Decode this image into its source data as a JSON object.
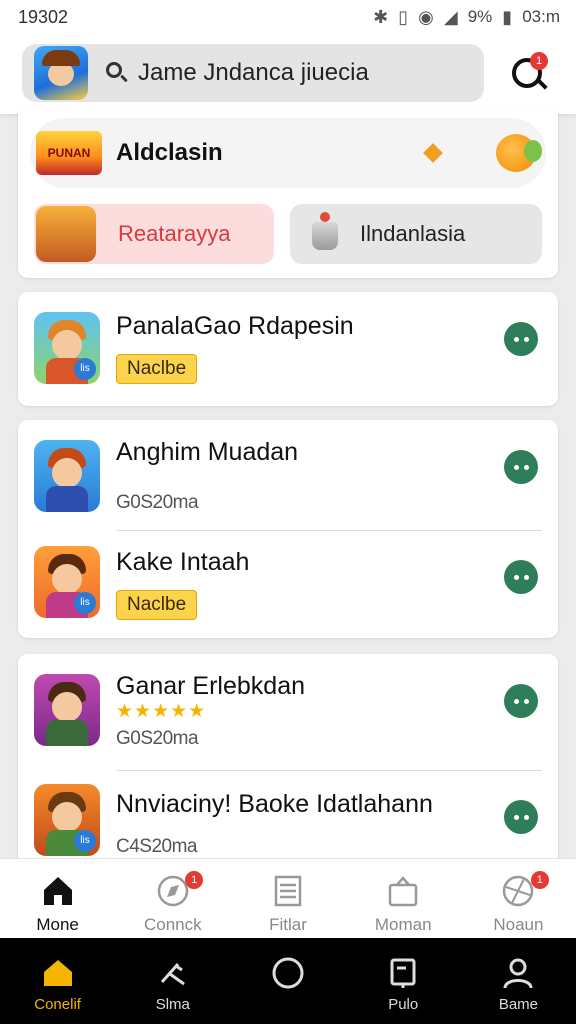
{
  "status_bar": {
    "time": "19302",
    "battery": "9%",
    "clock_right": "03:m"
  },
  "header": {
    "search_text": "Jame Jndanca jiuecia",
    "chat_badge": "1"
  },
  "promo": {
    "logo_text": "PUNAN",
    "title": "Aldclasin"
  },
  "categories": [
    {
      "label": "Reatarayya"
    },
    {
      "label": "Ilndanlasia"
    }
  ],
  "games": [
    {
      "title": "PanalaGao Rdapesin",
      "tag": "Naclbe",
      "badge": "lis"
    },
    {
      "title": "Anghim Muadan",
      "sub": "G0S20ma"
    },
    {
      "title": "Kake Intaah",
      "tag": "Naclbe",
      "badge": "lis"
    },
    {
      "title": "Ganar Erlebkdan",
      "sub": "G0S20ma",
      "stars": "★★★★★"
    },
    {
      "title": "Nnviaciny! Baoke Idatlahann",
      "sub": "C4S20ma",
      "badge": "lis"
    }
  ],
  "bottom_nav": [
    {
      "label": "Mone",
      "icon": "home-icon",
      "active": true
    },
    {
      "label": "Connck",
      "icon": "compass-icon",
      "badge": "1"
    },
    {
      "label": "Fitlar",
      "icon": "list-icon"
    },
    {
      "label": "Moman",
      "icon": "bag-icon"
    },
    {
      "label": "Noaun",
      "icon": "globe-icon",
      "badge": "1"
    }
  ],
  "system_bar": [
    {
      "label": "Conelif",
      "icon": "home-icon",
      "active": true
    },
    {
      "label": "Slma",
      "icon": "slash-icon"
    },
    {
      "label": "",
      "icon": "circle-icon"
    },
    {
      "label": "Pulo",
      "icon": "file-icon"
    },
    {
      "label": "Bame",
      "icon": "person-icon"
    }
  ],
  "colors": {
    "accent_green": "#2e7d5b",
    "tag_yellow": "#fcd34d",
    "badge_red": "#e53935",
    "active_gold": "#f5b400"
  }
}
